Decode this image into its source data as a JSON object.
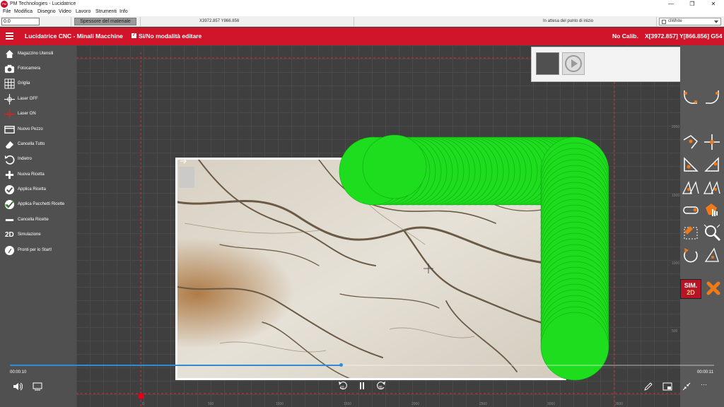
{
  "window": {
    "title": "PM Technologies - Lucidatrice",
    "app_icon_text": "PM",
    "minimize": "—",
    "maximize": "❐",
    "close": "✕"
  },
  "menu": {
    "items": [
      "File",
      "Modifica",
      "Disegno",
      "Video",
      "Lavoro",
      "Strumenti",
      "Info"
    ]
  },
  "statusbar": {
    "thickness_value": "0.0",
    "material_label": "Spessore del materiale",
    "coords": "X3972.857 Y866.856",
    "waiting": "In attesa del punto di inizio",
    "theme_value": "clWhite"
  },
  "header": {
    "app_title": "Lucidatrice CNC - Minali Macchine",
    "edit_mode_label": "Si/No modalità editare",
    "calibration": "No Calib.",
    "coord_readout": "X[3972.857] Y[866.856] G54",
    "color": "#d0152b"
  },
  "sidebar": {
    "items": [
      {
        "label": "Magazzino Utensili",
        "icon": "home-icon"
      },
      {
        "label": "Fotocamera",
        "icon": "camera-icon"
      },
      {
        "label": "Griglia",
        "icon": "grid-icon"
      },
      {
        "label": "Laser OFF",
        "icon": "crosshair-icon"
      },
      {
        "label": "Laser ON",
        "icon": "laser-crosshair-icon"
      },
      {
        "label": "Nuovo Pezzo",
        "icon": "new-piece-icon"
      },
      {
        "label": "Cancella Tutto",
        "icon": "eraser-icon"
      },
      {
        "label": "Indietro",
        "icon": "undo-icon"
      },
      {
        "label": "Nuova Ricetta",
        "icon": "plus-icon"
      },
      {
        "label": "Applica Ricetta",
        "icon": "check-circle-icon"
      },
      {
        "label": "Applica Pacchetti Ricette",
        "icon": "double-check-icon"
      },
      {
        "label": "Cancella Ricette",
        "icon": "minus-icon"
      },
      {
        "label": "Simulazione",
        "icon": "2d-icon"
      },
      {
        "label": "Pronti per lo Start!",
        "icon": "rocket-icon"
      }
    ]
  },
  "sim_button": {
    "line1": "SIM.",
    "line2": "2D"
  },
  "rulers": {
    "right": [
      "2000",
      "1500",
      "1000",
      "500"
    ],
    "bottom": [
      "0",
      "500",
      "1000",
      "1500",
      "2000",
      "2500",
      "3000",
      "3500"
    ]
  },
  "playback": {
    "time_start": "00:00:10",
    "time_end": "00:00:11",
    "progress": 0.47,
    "skip_back_label": "10",
    "skip_forward_label": "30"
  },
  "colors": {
    "toolpath": "#1edc1e",
    "accent": "#2f8bd8"
  }
}
